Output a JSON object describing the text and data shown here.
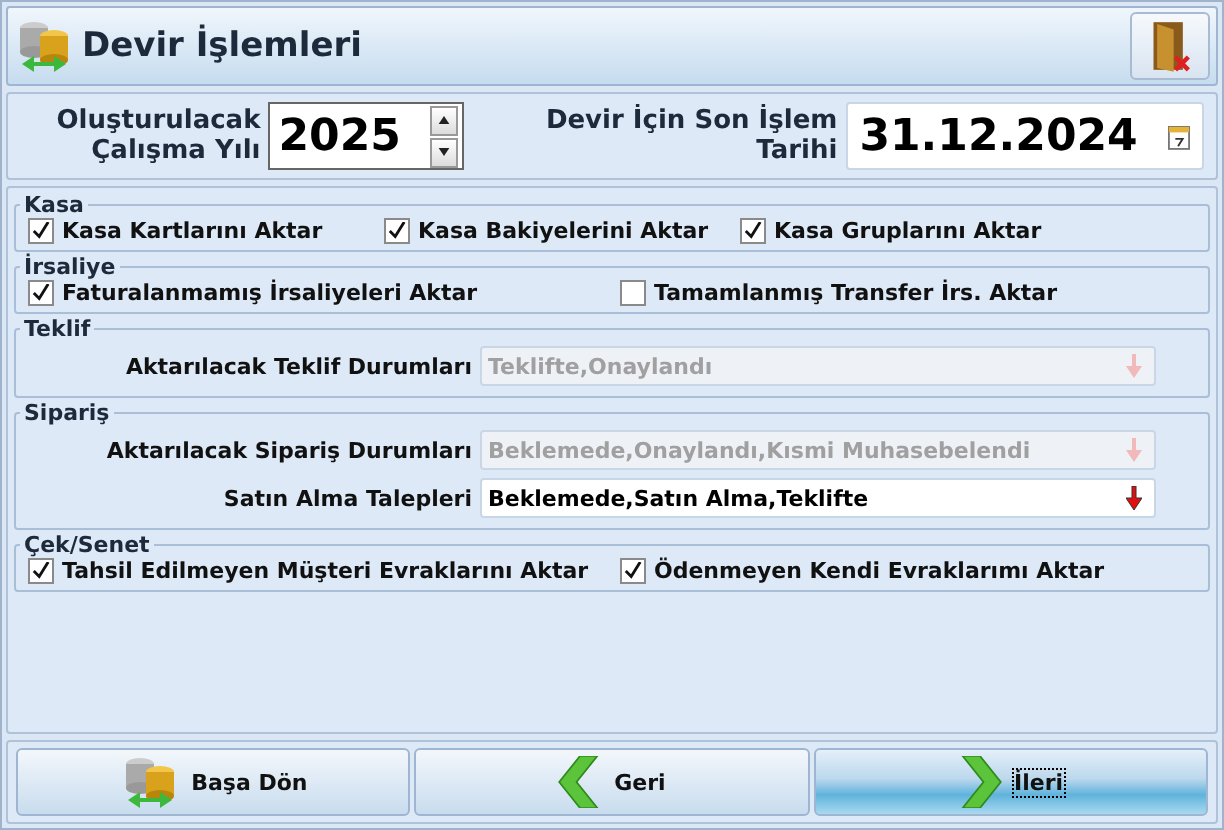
{
  "window": {
    "title": "Devir İşlemleri"
  },
  "header": {
    "year_label": "Oluşturulacak Çalışma Yılı",
    "year": "2025",
    "date_label": "Devir İçin Son İşlem Tarihi",
    "date": "31.12.2024"
  },
  "groups": [
    {
      "title": "Kasa",
      "kind": "checks",
      "items": [
        {
          "label": "Kasa Kartlarını Aktar",
          "checked": true
        },
        {
          "label": "Kasa Bakiyelerini Aktar",
          "checked": true
        },
        {
          "label": "Kasa Gruplarını Aktar",
          "checked": true
        }
      ]
    },
    {
      "title": "İrsaliye",
      "kind": "checks",
      "items": [
        {
          "label": "Faturalanmamış İrsaliyeleri Aktar",
          "checked": true
        },
        {
          "label": "Tamamlanmış Transfer İrs. Aktar",
          "checked": false
        }
      ]
    },
    {
      "title": "Teklif",
      "kind": "combos",
      "items": [
        {
          "label": "Aktarılacak Teklif Durumları",
          "value": "Teklifte,Onaylandı",
          "disabled": true
        }
      ]
    },
    {
      "title": "Sipariş",
      "kind": "combos",
      "items": [
        {
          "label": "Aktarılacak Sipariş Durumları",
          "value": "Beklemede,Onaylandı,Kısmi Muhasebelendi",
          "disabled": true
        },
        {
          "label": "Satın Alma Talepleri",
          "value": "Beklemede,Satın Alma,Teklifte",
          "disabled": false
        }
      ]
    },
    {
      "title": "Çek/Senet",
      "kind": "checks",
      "items": [
        {
          "label": "Tahsil Edilmeyen Müşteri Evraklarını Aktar",
          "checked": true
        },
        {
          "label": "Ödenmeyen Kendi Evraklarımı Aktar",
          "checked": true
        }
      ]
    }
  ],
  "buttons": [
    {
      "label": "Başa Dön",
      "kind": "home",
      "selected": false
    },
    {
      "label": "Geri",
      "kind": "back",
      "selected": false
    },
    {
      "label": "İleri",
      "kind": "next",
      "selected": true
    }
  ]
}
